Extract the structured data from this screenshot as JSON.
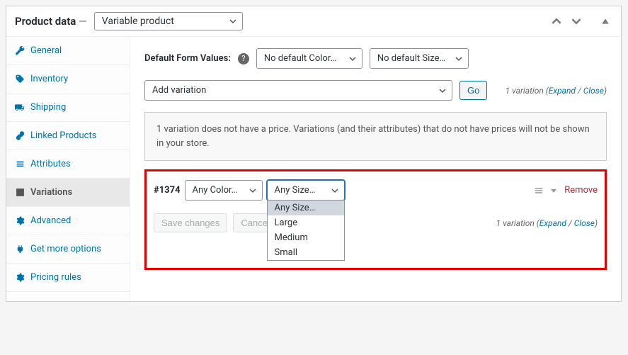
{
  "header": {
    "title_prefix": "Product data",
    "dash": " — ",
    "product_type": "Variable product"
  },
  "sidebar": {
    "items": [
      {
        "id": "general",
        "label": "General"
      },
      {
        "id": "inventory",
        "label": "Inventory"
      },
      {
        "id": "shipping",
        "label": "Shipping"
      },
      {
        "id": "linked",
        "label": "Linked Products"
      },
      {
        "id": "attributes",
        "label": "Attributes"
      },
      {
        "id": "variations",
        "label": "Variations"
      },
      {
        "id": "advanced",
        "label": "Advanced"
      },
      {
        "id": "getmore",
        "label": "Get more options"
      },
      {
        "id": "pricing",
        "label": "Pricing rules"
      }
    ]
  },
  "defaults": {
    "label": "Default Form Values:",
    "color": "No default Color…",
    "size": "No default Size…"
  },
  "addvar": {
    "label": "Add variation",
    "go": "Go"
  },
  "meta": {
    "count_text": "1 variation",
    "expand": "Expand",
    "close": "Close",
    "sep": " / ",
    "open_paren": " (",
    "close_paren": ")"
  },
  "notice": "1 variation does not have a price. Variations (and their attributes) that do not have prices will not be shown in your store.",
  "variation": {
    "id": "#1374",
    "color_sel": "Any Color…",
    "size_sel": "Any Size…",
    "size_options": [
      "Any Size…",
      "Large",
      "Medium",
      "Small"
    ],
    "remove": "Remove"
  },
  "buttons": {
    "save": "Save changes",
    "cancel": "Cancel"
  }
}
